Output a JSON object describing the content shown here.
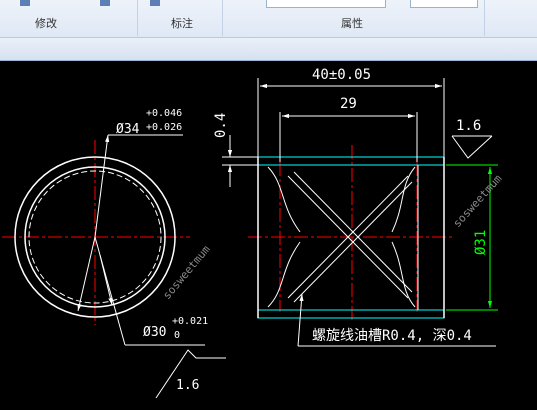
{
  "ribbon": {
    "group_modify": "修改",
    "group_annotate": "标注",
    "group_properties": "属性"
  },
  "drawing": {
    "outer_dia_base": "Ø34",
    "outer_dia_upper": "+0.046",
    "outer_dia_lower": "+0.026",
    "inner_dia_base": "Ø30",
    "inner_dia_upper": "+0.021",
    "inner_dia_lower": "0",
    "overall_length": "40±0.05",
    "groove_length": "29",
    "wall_thickness": "0.4",
    "roughness_right": "1.6",
    "roughness_left": "1.6",
    "bore_dia": "Ø31",
    "groove_note": "螺旋线油槽R0.4, 深0.4",
    "watermark_left": "sosweetmum",
    "watermark_right": "sosweetmum"
  },
  "colors": {
    "background": "#000000",
    "line": "#ffffff",
    "center_line": "#ff0000",
    "dimension_green": "#00ff00",
    "section_hatch": "#00ffff"
  }
}
